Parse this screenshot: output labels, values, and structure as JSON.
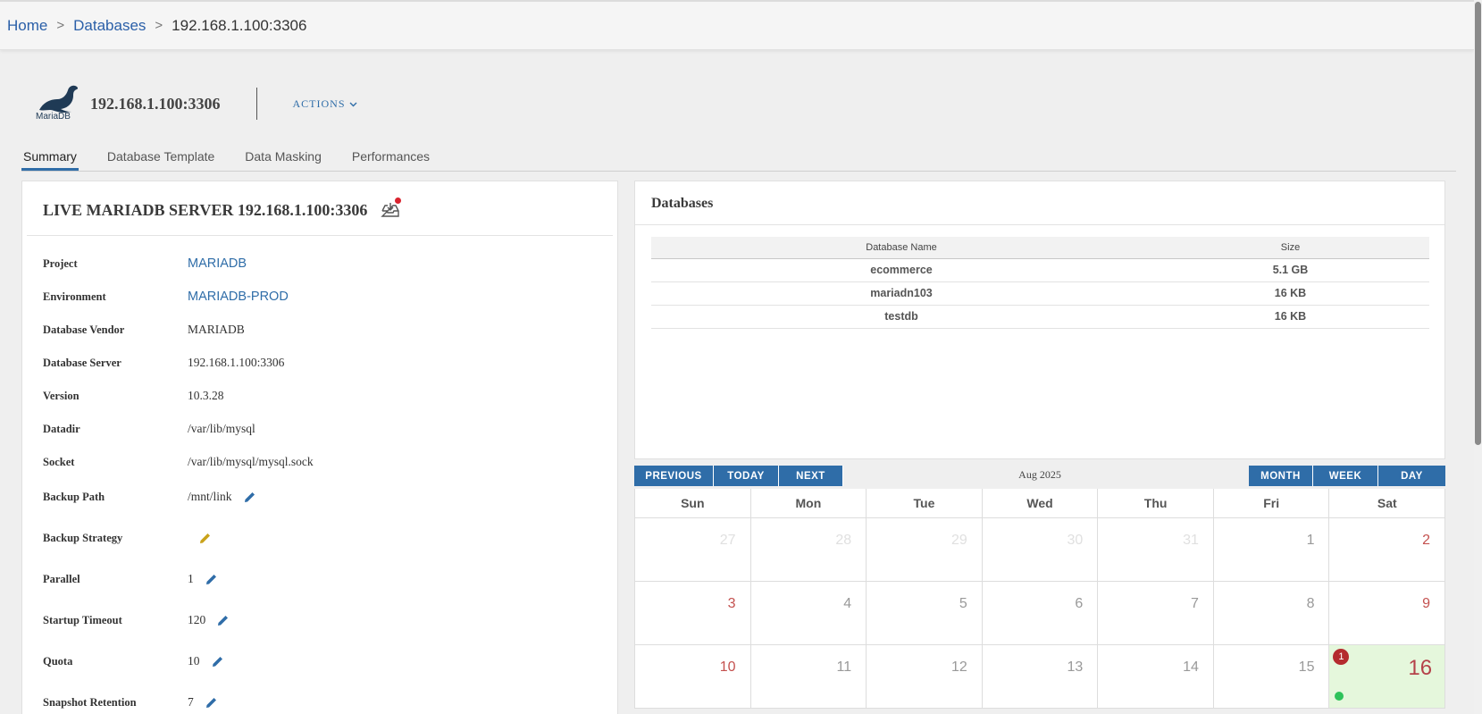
{
  "breadcrumb": {
    "home": "Home",
    "databases": "Databases",
    "current": "192.168.1.100:3306",
    "separator": ">"
  },
  "header": {
    "logo_text": "MariaDB",
    "server_name": "192.168.1.100:3306",
    "actions_label": "ACTIONS"
  },
  "tabs": [
    {
      "label": "Summary",
      "active": true
    },
    {
      "label": "Database Template",
      "active": false
    },
    {
      "label": "Data Masking",
      "active": false
    },
    {
      "label": "Performances",
      "active": false
    }
  ],
  "summary": {
    "title": "LIVE MARIADB SERVER 192.168.1.100:3306",
    "props": {
      "project": {
        "label": "Project",
        "value": "MARIADB"
      },
      "environment": {
        "label": "Environment",
        "value": "MARIADB-PROD"
      },
      "vendor": {
        "label": "Database Vendor",
        "value": "MARIADB"
      },
      "server": {
        "label": "Database Server",
        "value": "192.168.1.100:3306"
      },
      "version": {
        "label": "Version",
        "value": "10.3.28"
      },
      "datadir": {
        "label": "Datadir",
        "value": "/var/lib/mysql"
      },
      "socket": {
        "label": "Socket",
        "value": "/var/lib/mysql/mysql.sock"
      },
      "backup_path": {
        "label": "Backup Path",
        "value": "/mnt/link"
      },
      "backup_strategy": {
        "label": "Backup Strategy",
        "value": ""
      },
      "parallel": {
        "label": "Parallel",
        "value": "1"
      },
      "startup_timeout": {
        "label": "Startup Timeout",
        "value": "120"
      },
      "quota": {
        "label": "Quota",
        "value": "10"
      },
      "snapshot_retention": {
        "label": "Snapshot Retention",
        "value": "7"
      }
    }
  },
  "databases": {
    "title": "Databases",
    "columns": [
      "Database Name",
      "Size"
    ],
    "rows": [
      {
        "name": "ecommerce",
        "size": "5.1 GB"
      },
      {
        "name": "mariadn103",
        "size": "16 KB"
      },
      {
        "name": "testdb",
        "size": "16 KB"
      }
    ]
  },
  "calendar": {
    "title": "Aug 2025",
    "buttons": {
      "previous": "PREVIOUS",
      "today": "TODAY",
      "next": "NEXT",
      "month": "MONTH",
      "week": "WEEK",
      "day": "DAY"
    },
    "weekdays": [
      "Sun",
      "Mon",
      "Tue",
      "Wed",
      "Thu",
      "Fri",
      "Sat"
    ],
    "weeks": [
      [
        "27",
        "28",
        "29",
        "30",
        "31",
        "1",
        "2"
      ],
      [
        "3",
        "4",
        "5",
        "6",
        "7",
        "8",
        "9"
      ],
      [
        "10",
        "11",
        "12",
        "13",
        "14",
        "15",
        "16"
      ]
    ],
    "today_badge": "1"
  },
  "colors": {
    "accent": "#2f6da8",
    "link": "#2a5fa8",
    "today_bg": "#e5f7dc",
    "badge_red": "#b42b2e",
    "event_green": "#2ec25a",
    "backup_strategy_icon": "#c9a21a"
  }
}
